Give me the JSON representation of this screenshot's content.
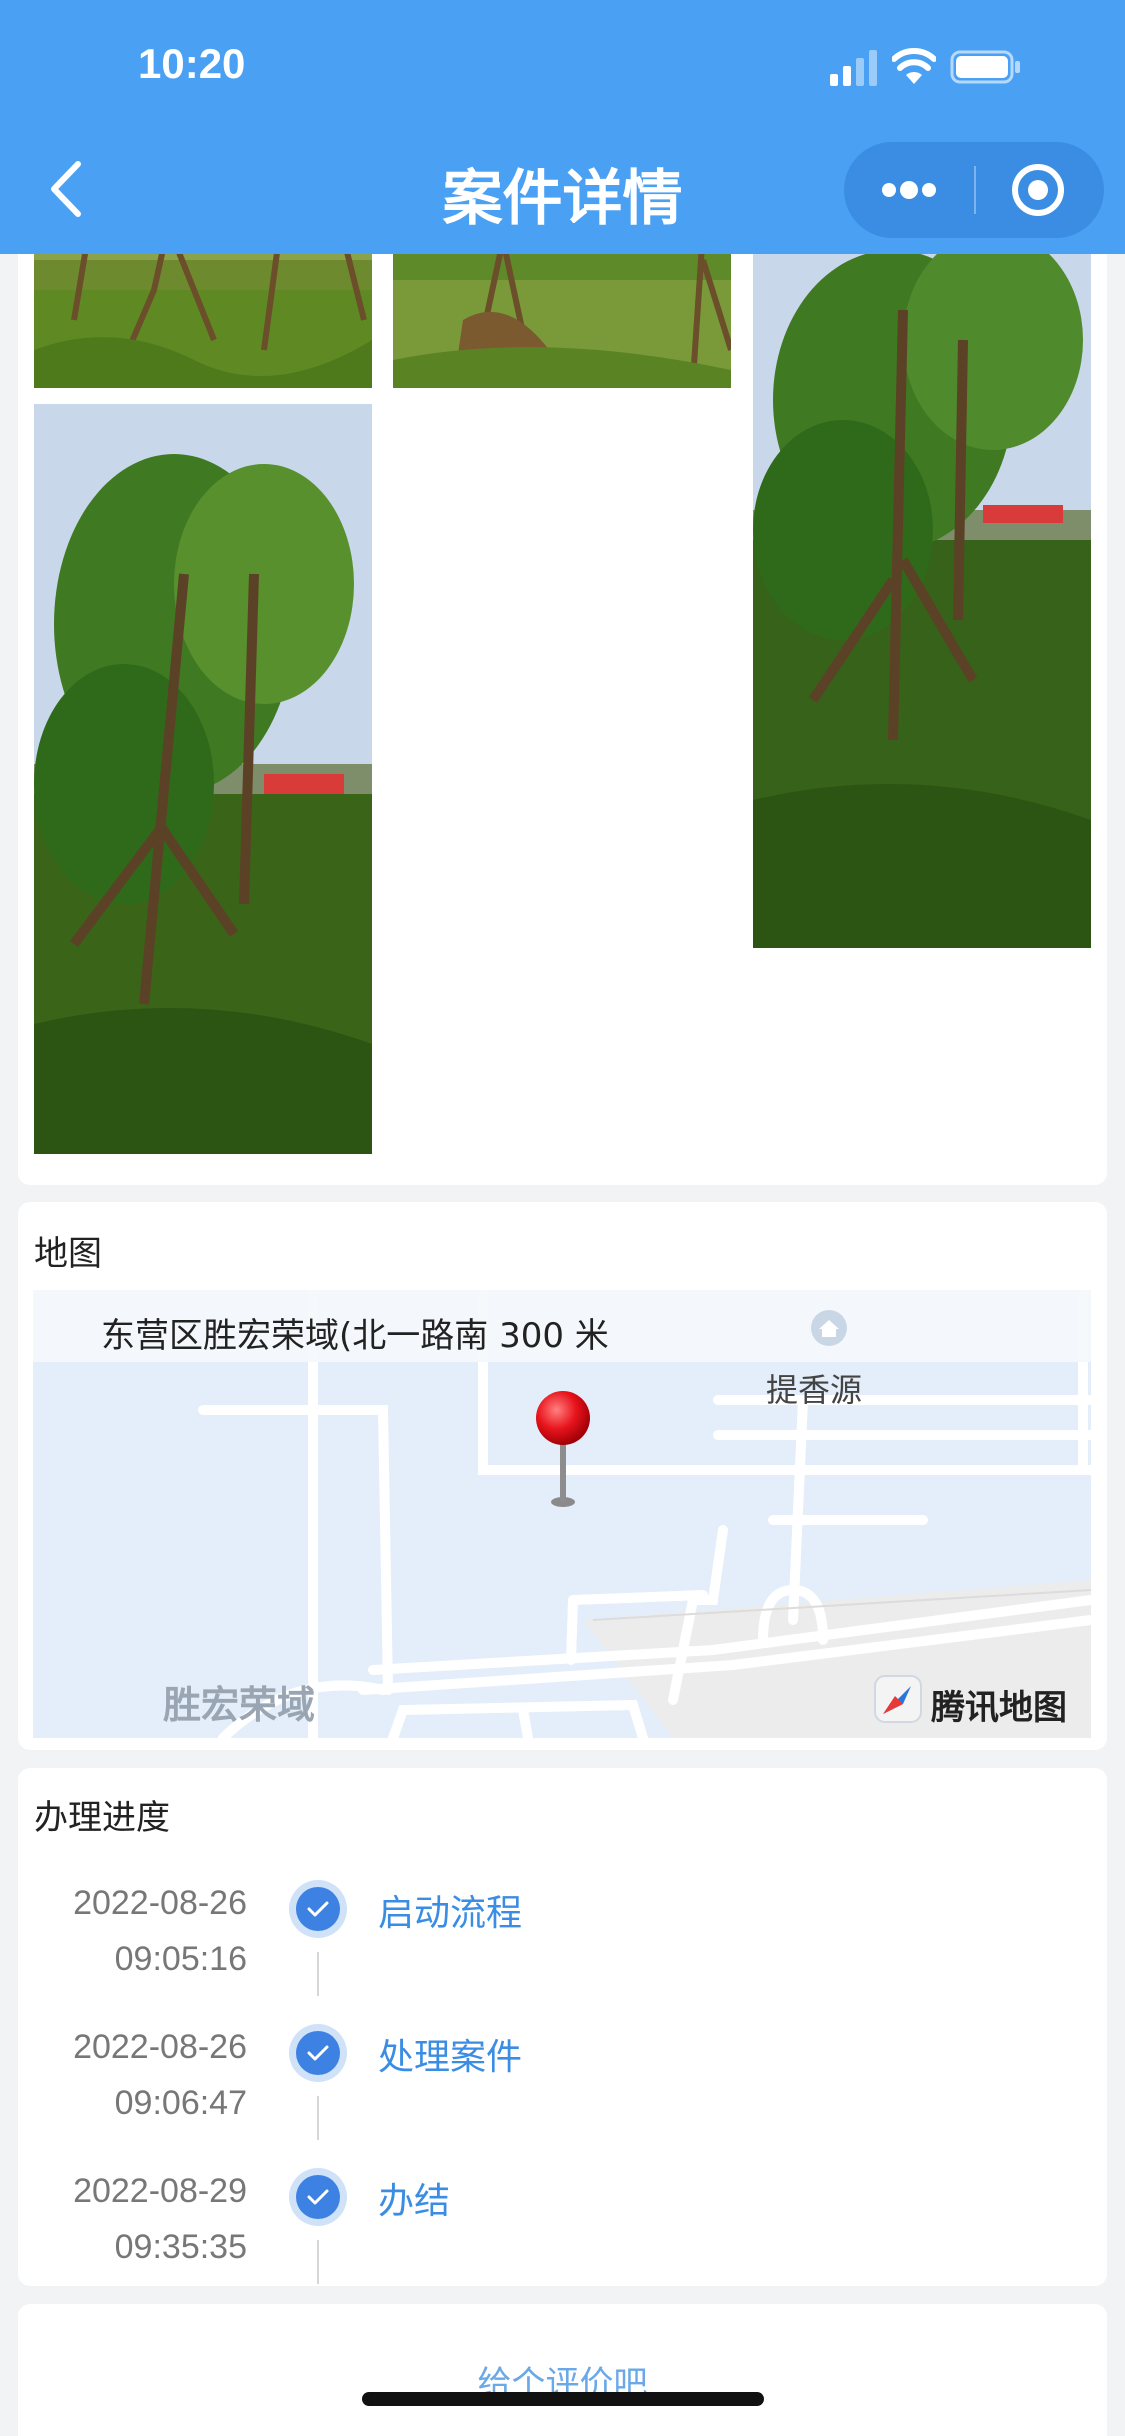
{
  "status_bar": {
    "time": "10:20"
  },
  "header": {
    "title": "案件详情",
    "back_icon": "chevron-left-icon",
    "more_icon": "more-dots-icon",
    "close_icon": "target-close-icon"
  },
  "photos": {
    "items": [
      {
        "name": "tree-photo-1",
        "description": "photo"
      },
      {
        "name": "tree-photo-2",
        "description": "photo"
      },
      {
        "name": "tree-photo-3",
        "description": "photo"
      },
      {
        "name": "tree-photo-4",
        "description": "photo"
      }
    ]
  },
  "map_section": {
    "title": "地图",
    "address": "东营区胜宏荣域(北一路南 300 米",
    "poi": "提香源",
    "district": "胜宏荣域",
    "brand": "腾讯地图",
    "colors": {
      "water": "#e3eefa",
      "marker": "#e8141c"
    }
  },
  "progress": {
    "title": "办理进度",
    "steps": [
      {
        "date": "2022-08-26",
        "time": "09:05:16",
        "label": "启动流程"
      },
      {
        "date": "2022-08-26",
        "time": "09:06:47",
        "label": "处理案件"
      },
      {
        "date": "2022-08-29",
        "time": "09:35:35",
        "label": "办结"
      }
    ]
  },
  "rating": {
    "link": "给个评价吧"
  },
  "colors": {
    "header": "#4aa0f3",
    "accent": "#3a8de3",
    "background": "#f2f3f5"
  }
}
